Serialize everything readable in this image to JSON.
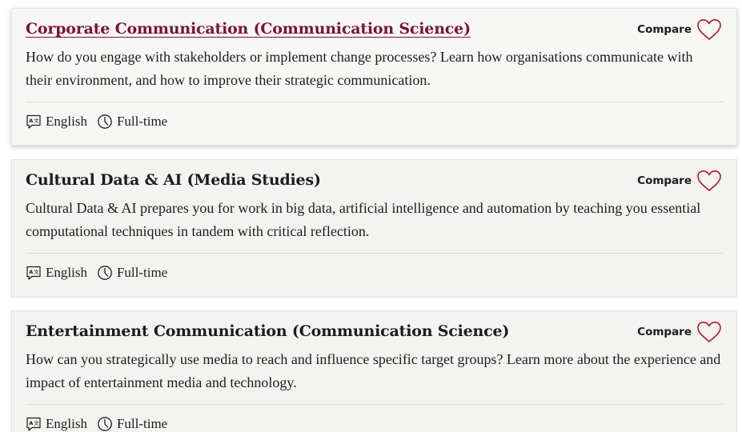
{
  "programmes": [
    {
      "title": "Corporate Communication (Communication Science)",
      "description": "How do you engage with stakeholders or implement change processes? Learn how organisations communicate with their environment, and how to improve their strategic communication.",
      "compare_label": "Compare",
      "language": "English",
      "mode": "Full-time"
    },
    {
      "title": "Cultural Data & AI (Media Studies)",
      "description": "Cultural Data & AI prepares you for work in big data, artificial intelligence and automation by teaching you essential computational techniques in tandem with critical reflection.",
      "compare_label": "Compare",
      "language": "English",
      "mode": "Full-time"
    },
    {
      "title": "Entertainment Communication (Communication Science)",
      "description": "How can you strategically use media to reach and influence specific target groups? Learn more about the experience and impact of entertainment media and technology.",
      "compare_label": "Compare",
      "language": "English",
      "mode": "Full-time"
    }
  ],
  "icons": {
    "heart": "heart-outline-icon",
    "language": "language-icon",
    "clock": "clock-icon"
  },
  "colors": {
    "accent": "#b0143f",
    "active_title": "#7a1436",
    "card_bg": "#f3f3f1"
  }
}
